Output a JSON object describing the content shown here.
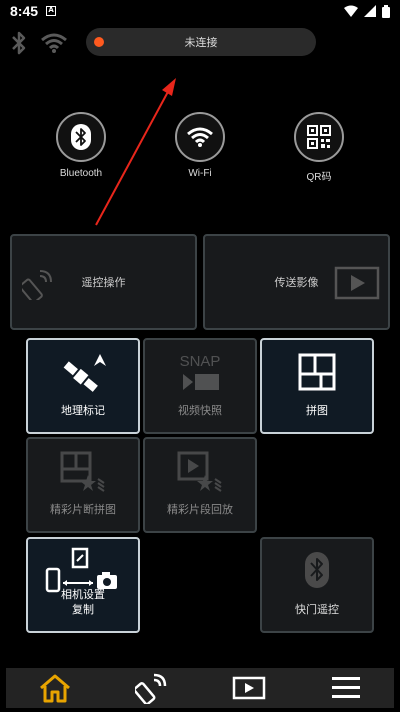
{
  "status": {
    "time": "8:45",
    "notif_letter": "A"
  },
  "connection": {
    "status_text": "未连接",
    "status_color": "#ff5a1f"
  },
  "connect_buttons": [
    {
      "label": "Bluetooth",
      "icon": "bluetooth-icon"
    },
    {
      "label": "Wi-Fi",
      "icon": "wifi-icon"
    },
    {
      "label": "QR码",
      "icon": "qr-code-icon"
    }
  ],
  "big_tiles": [
    {
      "label": "遥控操作",
      "icon": "remote-control-icon"
    },
    {
      "label": "传送影像",
      "icon": "play-icon"
    }
  ],
  "tiles": {
    "geotag": "地理标记",
    "video_snap": "视频快照",
    "video_snap_icon_text": "SNAP",
    "collage": "拼图",
    "highlight_collage": "精彩片断拼图",
    "highlight_playback": "精彩片段回放",
    "copy_settings_line1": "相机设置",
    "copy_settings_line2": "复制",
    "shutter_remote": "快门遥控"
  },
  "nav": [
    "home-icon",
    "remote-icon",
    "playback-icon",
    "menu-icon"
  ],
  "colors": {
    "accent": "#e8a400",
    "tile_border": "#3c4346",
    "active_border": "#c9d2d8"
  }
}
